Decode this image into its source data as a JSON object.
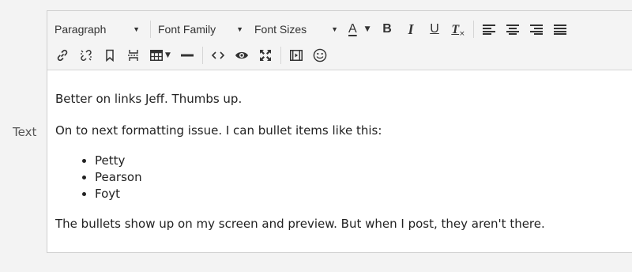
{
  "form": {
    "field_label": "Text"
  },
  "toolbar": {
    "block_format": "Paragraph",
    "font_family": "Font Family",
    "font_sizes": "Font Sizes",
    "text_color_glyph": "A",
    "bold_glyph": "B",
    "italic_glyph": "I",
    "underline_glyph": "U",
    "clear_format_glyph": "T"
  },
  "content": {
    "paragraph_1": "Better on links Jeff. Thumbs up.",
    "paragraph_2": "On to next formatting issue. I can bullet items like this:",
    "bullets": [
      "Petty",
      "Pearson",
      "Foyt"
    ],
    "paragraph_3": "The bullets show up on my screen and preview. But when I post, they aren't there."
  },
  "icons": {
    "row1": [
      "chevron-down-icon",
      "text-color-icon",
      "bold-icon",
      "italic-icon",
      "underline-icon",
      "clear-formatting-icon",
      "align-left-icon",
      "align-center-icon",
      "align-right-icon",
      "align-justify-icon"
    ],
    "row2": [
      "link-icon",
      "unlink-icon",
      "bookmark-icon",
      "page-break-icon",
      "table-icon",
      "horizontal-rule-icon",
      "code-icon",
      "preview-eye-icon",
      "fullscreen-icon",
      "media-icon",
      "emoji-icon"
    ]
  }
}
